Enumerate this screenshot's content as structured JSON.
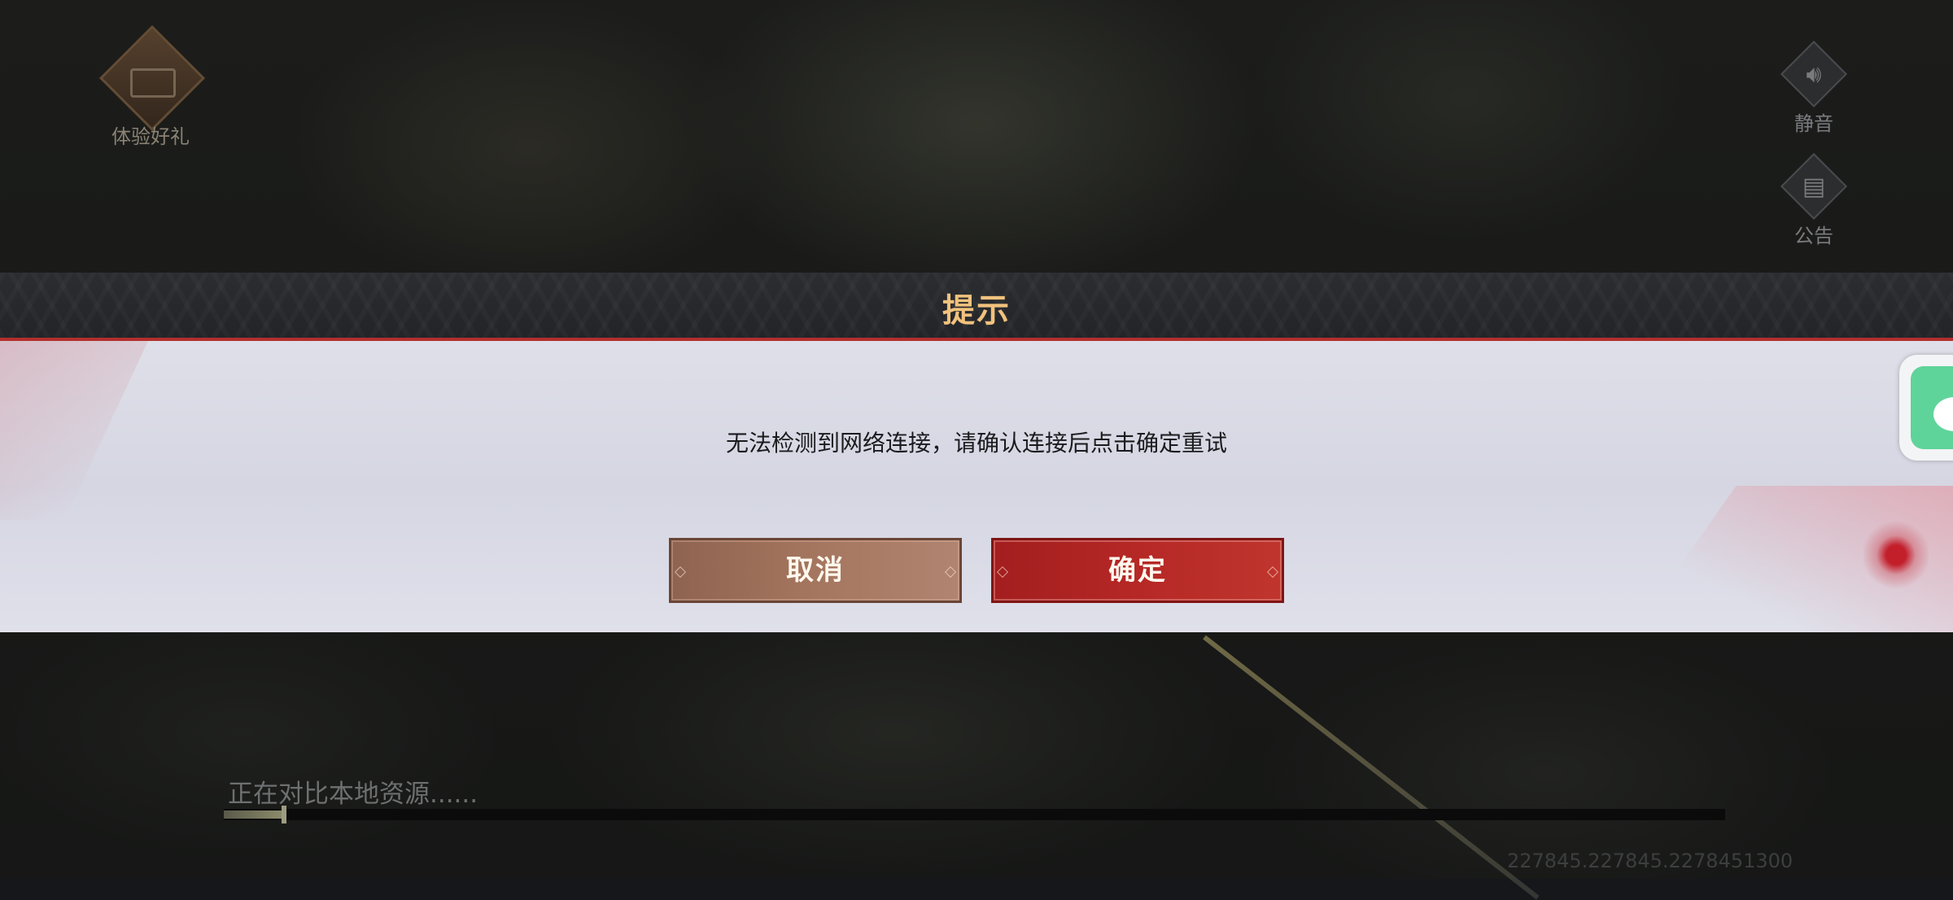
{
  "top_left": {
    "gift_label": "体验好礼",
    "gift_icon": "treasure-chest-icon"
  },
  "right_side": {
    "mute_label": "静音",
    "mute_icon": "speaker-icon",
    "notice_label": "公告",
    "notice_icon": "bulletin-icon"
  },
  "dialog": {
    "title": "提示",
    "message": "无法检测到网络连接，请确认连接后点击确定重试",
    "cancel_label": "取消",
    "confirm_label": "确定"
  },
  "loading": {
    "status_text": "正在对比本地资源......",
    "progress_fraction": 0.04
  },
  "version": "227845.227845.2278451300",
  "colors": {
    "title": "#f1c27d",
    "accent_red": "#b22f2d",
    "confirm_bg": "#b52826",
    "cancel_bg": "#a5765f",
    "wechat_green": "#5fd49a"
  }
}
